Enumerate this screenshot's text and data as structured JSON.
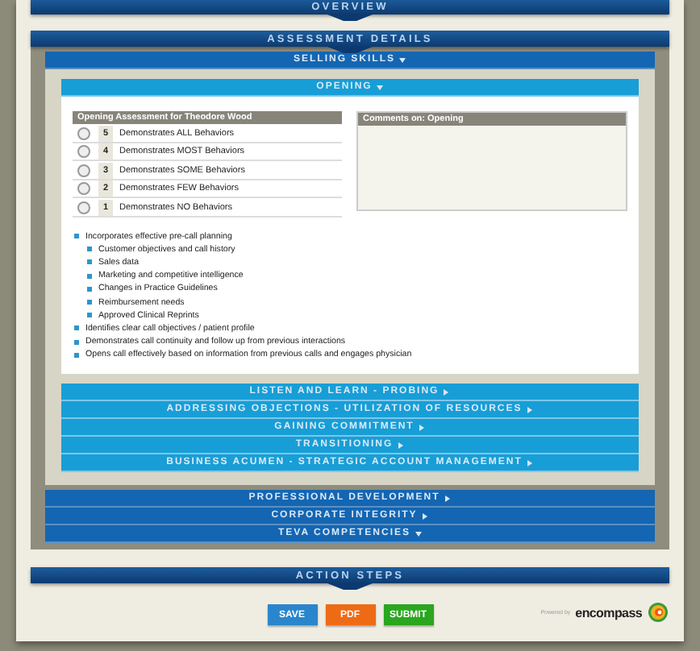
{
  "overview": {
    "title": "OVERVIEW"
  },
  "assessment": {
    "title": "ASSESSMENT DETAILS",
    "categories": [
      {
        "title": "SELLING SKILLS",
        "expanded": true,
        "skills": [
          {
            "title": "OPENING",
            "expanded": true
          },
          {
            "title": "LISTEN AND LEARN - PROBING",
            "expanded": false
          },
          {
            "title": "ADDRESSING OBJECTIONS - UTILIZATION OF RESOURCES",
            "expanded": false
          },
          {
            "title": "GAINING COMMITMENT",
            "expanded": false
          },
          {
            "title": "TRANSITIONING",
            "expanded": false
          },
          {
            "title": "BUSINESS ACUMEN - STRATEGIC ACCOUNT MANAGEMENT",
            "expanded": false
          }
        ]
      },
      {
        "title": "PROFESSIONAL DEVELOPMENT",
        "expanded": false
      },
      {
        "title": "CORPORATE INTEGRITY",
        "expanded": false
      },
      {
        "title": "TEVA COMPETENCIES",
        "expanded": true
      }
    ]
  },
  "opening": {
    "rating_header": "Opening Assessment for Theodore Wood",
    "ratings": [
      {
        "score": "5",
        "label": "Demonstrates ALL Behaviors",
        "selected": false
      },
      {
        "score": "4",
        "label": "Demonstrates MOST Behaviors",
        "selected": false
      },
      {
        "score": "3",
        "label": "Demonstrates SOME Behaviors",
        "selected": false
      },
      {
        "score": "2",
        "label": "Demonstrates FEW Behaviors",
        "selected": false
      },
      {
        "score": "1",
        "label": "Demonstrates NO Behaviors",
        "selected": false
      }
    ],
    "comments_label": "Comments on: Opening",
    "behaviors": [
      {
        "text": "Incorporates effective pre-call planning",
        "children": [
          {
            "text": "Customer objectives and call history"
          },
          {
            "text": "Sales data"
          },
          {
            "text": "Marketing and competitive intelligence"
          },
          {
            "text": "Changes in Practice Guidelines"
          },
          {
            "text": "Reimbursement needs"
          },
          {
            "text": "Approved Clinical Reprints"
          }
        ]
      },
      {
        "text": "Identifies clear call objectives / patient profile"
      },
      {
        "text": "Demonstrates call continuity and follow up from previous interactions"
      },
      {
        "text": "Opens call effectively based on information from previous calls and engages physician"
      }
    ]
  },
  "action_steps": {
    "title": "ACTION STEPS"
  },
  "buttons": [
    {
      "label": "SAVE",
      "kind": "save"
    },
    {
      "label": "PDF",
      "kind": "pdf"
    },
    {
      "label": "SUBMIT",
      "kind": "submit"
    }
  ],
  "footer": {
    "powered_by": "Powered by",
    "logo": "encompass"
  }
}
